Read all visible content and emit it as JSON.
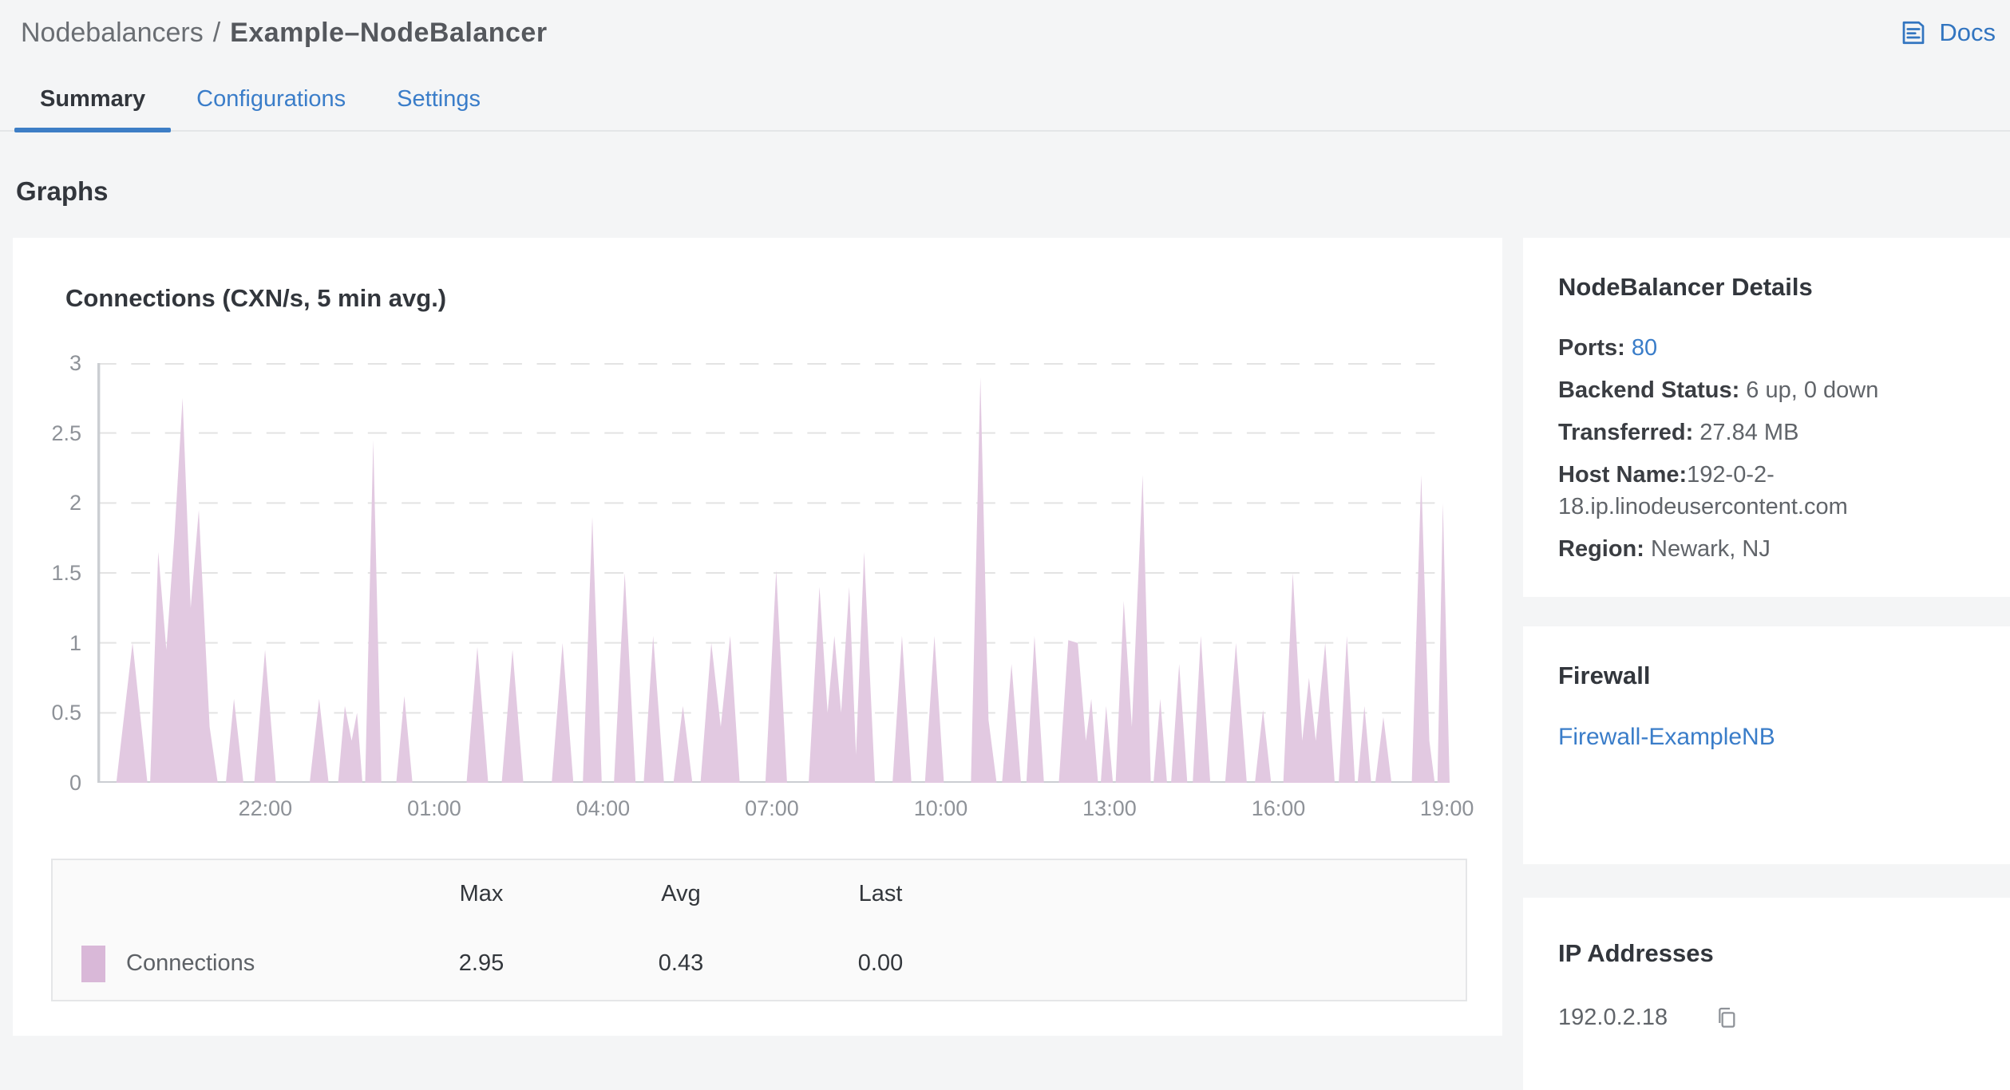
{
  "header": {
    "breadcrumb_section": "Nodebalancers",
    "breadcrumb_separator": "/",
    "page_title": "Example–NodeBalancer",
    "docs_label": "Docs"
  },
  "tabs": [
    {
      "label": "Summary",
      "active": true
    },
    {
      "label": "Configurations",
      "active": false
    },
    {
      "label": "Settings",
      "active": false
    }
  ],
  "section_title": "Graphs",
  "colors": {
    "accent_blue": "#3a7dc9",
    "tab_underline": "#3d7ec6",
    "area_fill": "#e2c9e1",
    "legend_swatch": "#d9b8d8",
    "grid_line": "#e3e3e3",
    "axis_line": "#cbced2",
    "page_background": "#f4f5f6",
    "card_background": "#ffffff"
  },
  "chart_data": {
    "type": "area",
    "title": "Connections (CXN/s, 5 min avg.)",
    "ylabel": "",
    "xlabel": "",
    "ylim": [
      0,
      3
    ],
    "y_ticks": [
      "0",
      "0.5",
      "1",
      "1.5",
      "2",
      "2.5",
      "3"
    ],
    "y_tick_values": [
      0,
      0.5,
      1,
      1.5,
      2,
      2.5,
      3
    ],
    "x_ticks": [
      {
        "label": "22:00",
        "pct": 12.42
      },
      {
        "label": "01:00",
        "pct": 24.91
      },
      {
        "label": "04:00",
        "pct": 37.39
      },
      {
        "label": "07:00",
        "pct": 49.88
      },
      {
        "label": "10:00",
        "pct": 62.37
      },
      {
        "label": "13:00",
        "pct": 74.85
      },
      {
        "label": "16:00",
        "pct": 87.34
      },
      {
        "label": "19:00",
        "pct": 99.8
      }
    ],
    "grid": "horizontal dashed",
    "legend_position": "table below chart",
    "series": [
      {
        "name": "Connections",
        "color": "#e2c9e1",
        "max": 2.95,
        "avg": 0.43,
        "last": 0.0
      }
    ],
    "area_points": [
      [
        0,
        0
      ],
      [
        1.4,
        0
      ],
      [
        2.6,
        1.0
      ],
      [
        3.7,
        0
      ],
      [
        3.9,
        0
      ],
      [
        4.5,
        1.65
      ],
      [
        5.1,
        0.95
      ],
      [
        5.7,
        1.77
      ],
      [
        6.3,
        2.75
      ],
      [
        6.9,
        1.25
      ],
      [
        7.5,
        1.95
      ],
      [
        8.3,
        0.4
      ],
      [
        8.9,
        0
      ],
      [
        9.5,
        0
      ],
      [
        10.1,
        0.6
      ],
      [
        10.8,
        0
      ],
      [
        11.6,
        0
      ],
      [
        12.4,
        0.95
      ],
      [
        13.2,
        0
      ],
      [
        15.7,
        0
      ],
      [
        16.4,
        0.6
      ],
      [
        17.1,
        0
      ],
      [
        17.8,
        0
      ],
      [
        18.3,
        0.55
      ],
      [
        18.8,
        0.3
      ],
      [
        19.2,
        0.5
      ],
      [
        19.6,
        0
      ],
      [
        19.8,
        0
      ],
      [
        20.4,
        2.45
      ],
      [
        21.0,
        0
      ],
      [
        22.1,
        0
      ],
      [
        22.7,
        0.62
      ],
      [
        23.3,
        0
      ],
      [
        27.3,
        0
      ],
      [
        28.1,
        0.97
      ],
      [
        28.9,
        0
      ],
      [
        29.9,
        0
      ],
      [
        30.7,
        0.95
      ],
      [
        31.5,
        0
      ],
      [
        33.6,
        0
      ],
      [
        34.4,
        1.0
      ],
      [
        35.2,
        0
      ],
      [
        35.9,
        0
      ],
      [
        36.6,
        1.9
      ],
      [
        37.3,
        0
      ],
      [
        38.2,
        0
      ],
      [
        39.0,
        1.5
      ],
      [
        39.8,
        0
      ],
      [
        40.4,
        0
      ],
      [
        41.1,
        1.05
      ],
      [
        41.9,
        0
      ],
      [
        42.6,
        0
      ],
      [
        43.3,
        0.55
      ],
      [
        44.0,
        0
      ],
      [
        44.6,
        0
      ],
      [
        45.4,
        1.0
      ],
      [
        46.1,
        0.4
      ],
      [
        46.8,
        1.05
      ],
      [
        47.5,
        0
      ],
      [
        49.4,
        0
      ],
      [
        50.2,
        1.52
      ],
      [
        51.0,
        0
      ],
      [
        52.6,
        0
      ],
      [
        53.4,
        1.4
      ],
      [
        54.0,
        0.5
      ],
      [
        54.5,
        1.05
      ],
      [
        55.0,
        0.5
      ],
      [
        55.6,
        1.4
      ],
      [
        56.1,
        0.2
      ],
      [
        56.7,
        1.65
      ],
      [
        57.5,
        0
      ],
      [
        58.8,
        0
      ],
      [
        59.5,
        1.05
      ],
      [
        60.2,
        0
      ],
      [
        61.2,
        0
      ],
      [
        61.9,
        1.05
      ],
      [
        62.6,
        0
      ],
      [
        64.6,
        0
      ],
      [
        65.3,
        2.9
      ],
      [
        65.9,
        0.45
      ],
      [
        66.5,
        0
      ],
      [
        66.9,
        0
      ],
      [
        67.6,
        0.85
      ],
      [
        68.3,
        0
      ],
      [
        68.7,
        0
      ],
      [
        69.3,
        1.05
      ],
      [
        70.0,
        0
      ],
      [
        71.1,
        0
      ],
      [
        71.8,
        1.02
      ],
      [
        72.5,
        1.0
      ],
      [
        73.1,
        0.3
      ],
      [
        73.5,
        0.6
      ],
      [
        74.0,
        0
      ],
      [
        74.2,
        0
      ],
      [
        74.6,
        0.55
      ],
      [
        75.1,
        0
      ],
      [
        75.3,
        0
      ],
      [
        75.9,
        1.3
      ],
      [
        76.5,
        0.4
      ],
      [
        77.3,
        2.2
      ],
      [
        77.9,
        0
      ],
      [
        78.1,
        0
      ],
      [
        78.6,
        0.6
      ],
      [
        79.1,
        0
      ],
      [
        79.4,
        0
      ],
      [
        80.0,
        0.85
      ],
      [
        80.6,
        0
      ],
      [
        81.0,
        0
      ],
      [
        81.6,
        1.05
      ],
      [
        82.3,
        0
      ],
      [
        83.4,
        0
      ],
      [
        84.2,
        1.0
      ],
      [
        85.0,
        0
      ],
      [
        85.6,
        0
      ],
      [
        86.2,
        0.52
      ],
      [
        86.8,
        0
      ],
      [
        87.7,
        0
      ],
      [
        88.4,
        1.5
      ],
      [
        89.1,
        0.3
      ],
      [
        89.6,
        0.75
      ],
      [
        90.1,
        0.3
      ],
      [
        90.8,
        1.0
      ],
      [
        91.5,
        0
      ],
      [
        91.8,
        0
      ],
      [
        92.4,
        1.05
      ],
      [
        93.0,
        0
      ],
      [
        93.2,
        0
      ],
      [
        93.7,
        0.55
      ],
      [
        94.2,
        0
      ],
      [
        94.5,
        0
      ],
      [
        95.1,
        0.47
      ],
      [
        95.7,
        0
      ],
      [
        97.2,
        0
      ],
      [
        97.9,
        2.2
      ],
      [
        98.5,
        0.3
      ],
      [
        98.9,
        0
      ],
      [
        99.1,
        0
      ],
      [
        99.5,
        2.0
      ],
      [
        100,
        0
      ]
    ],
    "legend_table": {
      "columns": [
        "Max",
        "Avg",
        "Last"
      ],
      "rows": [
        {
          "name": "Connections",
          "max": "2.95",
          "avg": "0.43",
          "last": "0.00"
        }
      ]
    }
  },
  "details_card": {
    "title": "NodeBalancer Details",
    "ports_label": "Ports: ",
    "ports_value": "80",
    "backend_label": "Backend Status: ",
    "backend_value": "6 up, 0 down",
    "transferred_label": "Transferred: ",
    "transferred_value": "27.84 MB",
    "hostname_label": "Host Name:",
    "hostname_value": "192-0-2-18.ip.linodeusercontent.com",
    "region_label": "Region: ",
    "region_value": "Newark, NJ"
  },
  "firewall_card": {
    "title": "Firewall",
    "link_label": "Firewall-ExampleNB"
  },
  "ip_card": {
    "title": "IP Addresses",
    "ip": "192.0.2.18"
  }
}
